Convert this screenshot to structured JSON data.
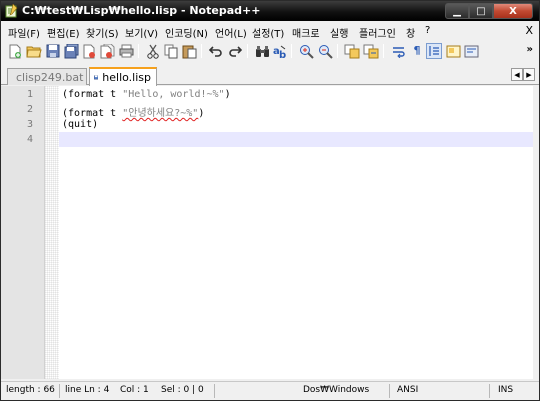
{
  "window": {
    "title": "C:\\test\\Lisp\\hello.lisp - Notepad++",
    "title_display": "C:₩test₩Lisp₩hello.lisp - Notepad++",
    "minimize": "▁",
    "maximize": "□",
    "close": "X"
  },
  "menu": {
    "items": [
      "파일(F)",
      "편집(E)",
      "찾기(S)",
      "보기(V)",
      "인코딩(N)",
      "언어(L)",
      "설정(T)",
      "매크로",
      "실행",
      "플러그인",
      "창",
      "?"
    ],
    "close_doc": "X"
  },
  "toolbar": {
    "icons": [
      "new-file-icon",
      "open-file-icon",
      "save-icon",
      "save-all-icon",
      "close-icon",
      "close-all-icon",
      "print-icon",
      "cut-icon",
      "copy-icon",
      "paste-icon",
      "undo-icon",
      "redo-icon",
      "find-icon",
      "replace-icon",
      "zoom-in-icon",
      "zoom-out-icon",
      "sync-v-icon",
      "sync-h-icon",
      "wrap-icon",
      "show-all-chars-icon",
      "indent-guide-icon",
      "doc-map-icon"
    ],
    "overflow": "»"
  },
  "tabs": [
    {
      "label": "clisp249.bat",
      "active": false
    },
    {
      "label": "hello.lisp",
      "active": true
    }
  ],
  "tab_nav": {
    "left": "◀",
    "right": "▶"
  },
  "editor": {
    "line_numbers": [
      "1",
      "2",
      "3",
      "4"
    ],
    "lines": [
      {
        "pre": "(format t ",
        "str": "\"Hello, world!~%\"",
        "post": ")"
      },
      {
        "pre": "(format t ",
        "str": "\"안녕하세요?~%\"",
        "post": ")"
      },
      {
        "pre": "(quit)",
        "str": "",
        "post": ""
      },
      {
        "pre": "",
        "str": "",
        "post": ""
      }
    ],
    "current_line": 4
  },
  "status": {
    "length": "length : 66",
    "line": "line Ln : 4",
    "col": "Col : 1",
    "sel": "Sel : 0 | 0",
    "eol": "Dos\\Windows",
    "eol_display": "Dos₩Windows",
    "encoding": "ANSI",
    "mode": "INS"
  },
  "colors": {
    "tab_accent": "#f6a11d",
    "current_line": "#e8e8ff",
    "string_color": "#808080"
  }
}
